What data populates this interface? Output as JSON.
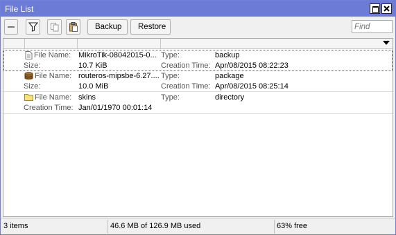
{
  "window": {
    "title": "File List"
  },
  "toolbar": {
    "backup_label": "Backup",
    "restore_label": "Restore",
    "find_placeholder": "Find"
  },
  "field_labels": {
    "file_name": "File Name:",
    "size": "Size:",
    "type": "Type:",
    "creation_time": "Creation Time:"
  },
  "files": [
    {
      "icon": "document-icon",
      "file_name": "MikroTik-08042015-0...",
      "size": "10.7 KiB",
      "type": "backup",
      "creation_time": "Apr/08/2015 08:22:23"
    },
    {
      "icon": "package-icon",
      "file_name": "routeros-mipsbe-6.27....",
      "size": "10.0 MiB",
      "type": "package",
      "creation_time": "Apr/08/2015 08:25:14"
    },
    {
      "icon": "folder-icon",
      "file_name": "skins",
      "type": "directory",
      "creation_time": "Jan/01/1970 00:01:14"
    }
  ],
  "status": {
    "items": "3 items",
    "usage": "46.6 MB of 126.9 MB used",
    "free": "63% free"
  },
  "colors": {
    "titlebar": "#6b7bd6",
    "folder": "#f5e27a"
  }
}
